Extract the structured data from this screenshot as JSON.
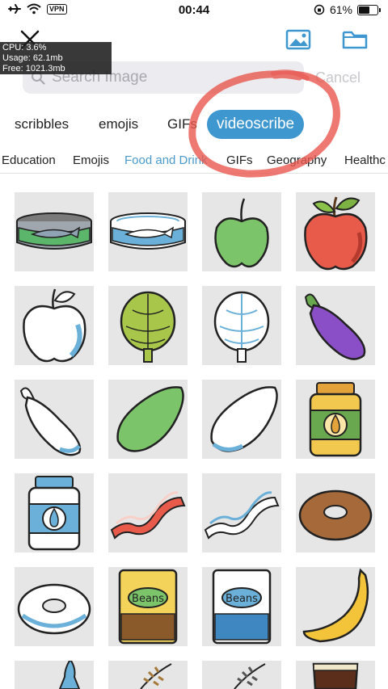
{
  "status_bar": {
    "vpn_label": "VPN",
    "time": "00:44",
    "battery_percent": "61%",
    "battery_level": 0.61
  },
  "debug_overlay": {
    "cpu": "CPU: 3.6%",
    "usage": "Usage: 62.1mb",
    "free": "Free: 1021.3mb"
  },
  "search": {
    "placeholder": "Search Image",
    "value": "",
    "cancel_label": "Cancel"
  },
  "sources": [
    {
      "label": "scribbles",
      "active": false
    },
    {
      "label": "emojis",
      "active": false
    },
    {
      "label": "GIFs",
      "active": false
    },
    {
      "label": "videoscribe",
      "active": true
    }
  ],
  "categories": [
    {
      "label": "Education",
      "active": false
    },
    {
      "label": "Emojis",
      "active": false
    },
    {
      "label": "Food and Drink",
      "active": true
    },
    {
      "label": "GIFs",
      "active": false
    },
    {
      "label": "Geography",
      "active": false
    },
    {
      "label": "Healthc",
      "active": false
    }
  ],
  "colors": {
    "accent": "#3f97cf",
    "active_category": "#4a9acc",
    "annotation_red": "#e8574f",
    "tile_bg": "#e6e6e6"
  },
  "images": [
    {
      "name": "sardine-can-color-icon"
    },
    {
      "name": "sardine-can-blue-icon"
    },
    {
      "name": "green-apple-icon"
    },
    {
      "name": "red-apple-icon"
    },
    {
      "name": "apple-outline-icon"
    },
    {
      "name": "artichoke-green-icon"
    },
    {
      "name": "artichoke-outline-icon"
    },
    {
      "name": "eggplant-purple-icon"
    },
    {
      "name": "eggplant-outline-icon"
    },
    {
      "name": "avocado-green-icon"
    },
    {
      "name": "avocado-outline-icon"
    },
    {
      "name": "pear-jar-color-icon"
    },
    {
      "name": "pear-jar-blue-icon"
    },
    {
      "name": "bacon-color-icon"
    },
    {
      "name": "bacon-outline-icon"
    },
    {
      "name": "bagel-color-icon"
    },
    {
      "name": "bagel-outline-icon",
      "label": ""
    },
    {
      "name": "beans-can-color-icon",
      "label": "Beans"
    },
    {
      "name": "beans-can-blue-icon",
      "label": "Beans"
    },
    {
      "name": "banana-icon"
    },
    {
      "name": "bottle-partial-icon"
    },
    {
      "name": "wheat-color-icon"
    },
    {
      "name": "wheat-outline-icon"
    },
    {
      "name": "beer-glass-icon"
    }
  ]
}
